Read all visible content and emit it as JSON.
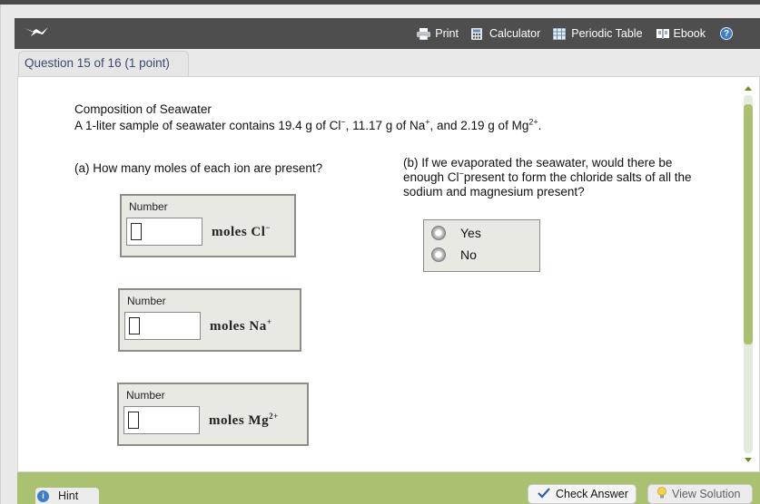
{
  "toolbar": {
    "items": [
      {
        "label": "Print",
        "icon": "printer-icon"
      },
      {
        "label": "Calculator",
        "icon": "calculator-icon"
      },
      {
        "label": "Periodic Table",
        "icon": "periodic-table-icon"
      },
      {
        "label": "Ebook",
        "icon": "book-icon"
      }
    ],
    "help_glyph": "?",
    "help_icon": "help-icon"
  },
  "logo_icon": "bird-logo-icon",
  "question": {
    "tab_label": "Question 15 of 16 (1 point)",
    "title": "Composition of Seawater",
    "statement_prefix": "A 1-liter sample of seawater contains 19.4 g of Cl",
    "statement_cl_charge": "−",
    "statement_mid1": ", 11.17 g of Na",
    "statement_na_charge": "+",
    "statement_mid2": ", and 2.19 g of Mg",
    "statement_mg_charge": "2+",
    "statement_end": ".",
    "part_a": "(a) How many moles of each ion are present?",
    "part_b_prefix": "(b) If we evaporated the seawater, would there be enough Cl",
    "part_b_charge": "−",
    "part_b_suffix": "present to form the chloride salts of all the sodium and magnesium present?"
  },
  "answers": [
    {
      "label": "Number",
      "value": "",
      "unit_text": "moles  Cl",
      "unit_charge": "−"
    },
    {
      "label": "Number",
      "value": "",
      "unit_text": "moles  Na",
      "unit_charge": "+"
    },
    {
      "label": "Number",
      "value": "",
      "unit_text": "moles  Mg",
      "unit_charge": "2+"
    }
  ],
  "choices": {
    "options": [
      "Yes",
      "No"
    ],
    "selected": null
  },
  "footer": {
    "hint_label": "Hint",
    "hint_glyph": "i",
    "check_label": "Check Answer",
    "view_solution_label": "View Solution"
  },
  "colors": {
    "header_bg": "#4e4e4e",
    "accent_green": "#a9c170",
    "tab_text": "#3b4a6e"
  }
}
